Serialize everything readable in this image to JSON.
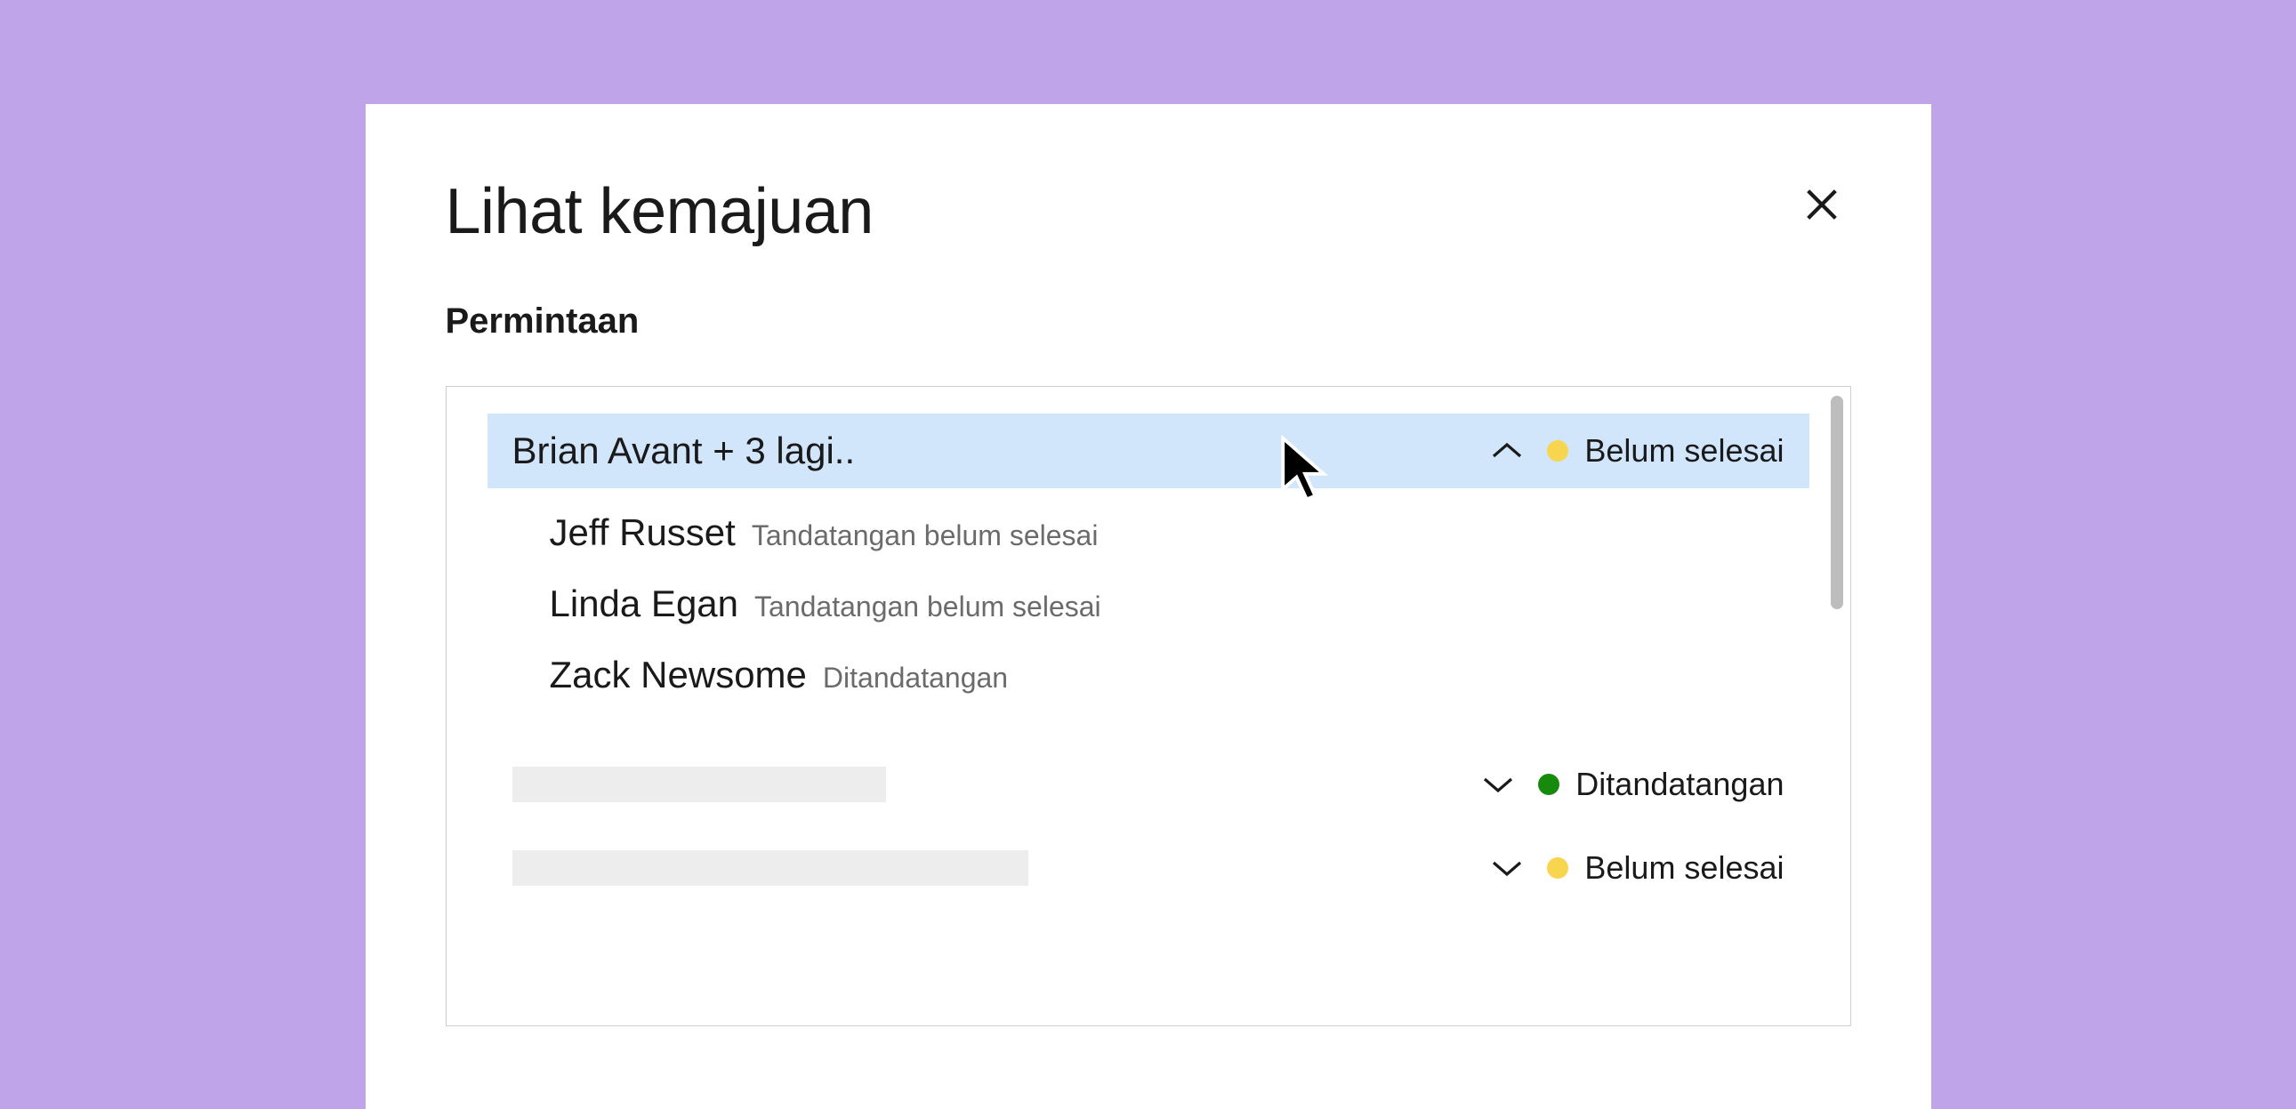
{
  "modal": {
    "title": "Lihat kemajuan",
    "section_label": "Permintaan"
  },
  "requests": [
    {
      "name": "Brian Avant + 3 lagi..",
      "expanded": true,
      "status_label": "Belum selesai",
      "status_color": "yellow",
      "children": [
        {
          "name": "Jeff Russet",
          "status": "Tandatangan belum selesai"
        },
        {
          "name": "Linda Egan",
          "status": "Tandatangan belum selesai"
        },
        {
          "name": "Zack Newsome",
          "status": "Ditandatangan"
        }
      ]
    },
    {
      "placeholder": true,
      "expanded": false,
      "status_label": "Ditandatangan",
      "status_color": "green"
    },
    {
      "placeholder": true,
      "expanded": false,
      "status_label": "Belum selesai",
      "status_color": "yellow"
    }
  ]
}
